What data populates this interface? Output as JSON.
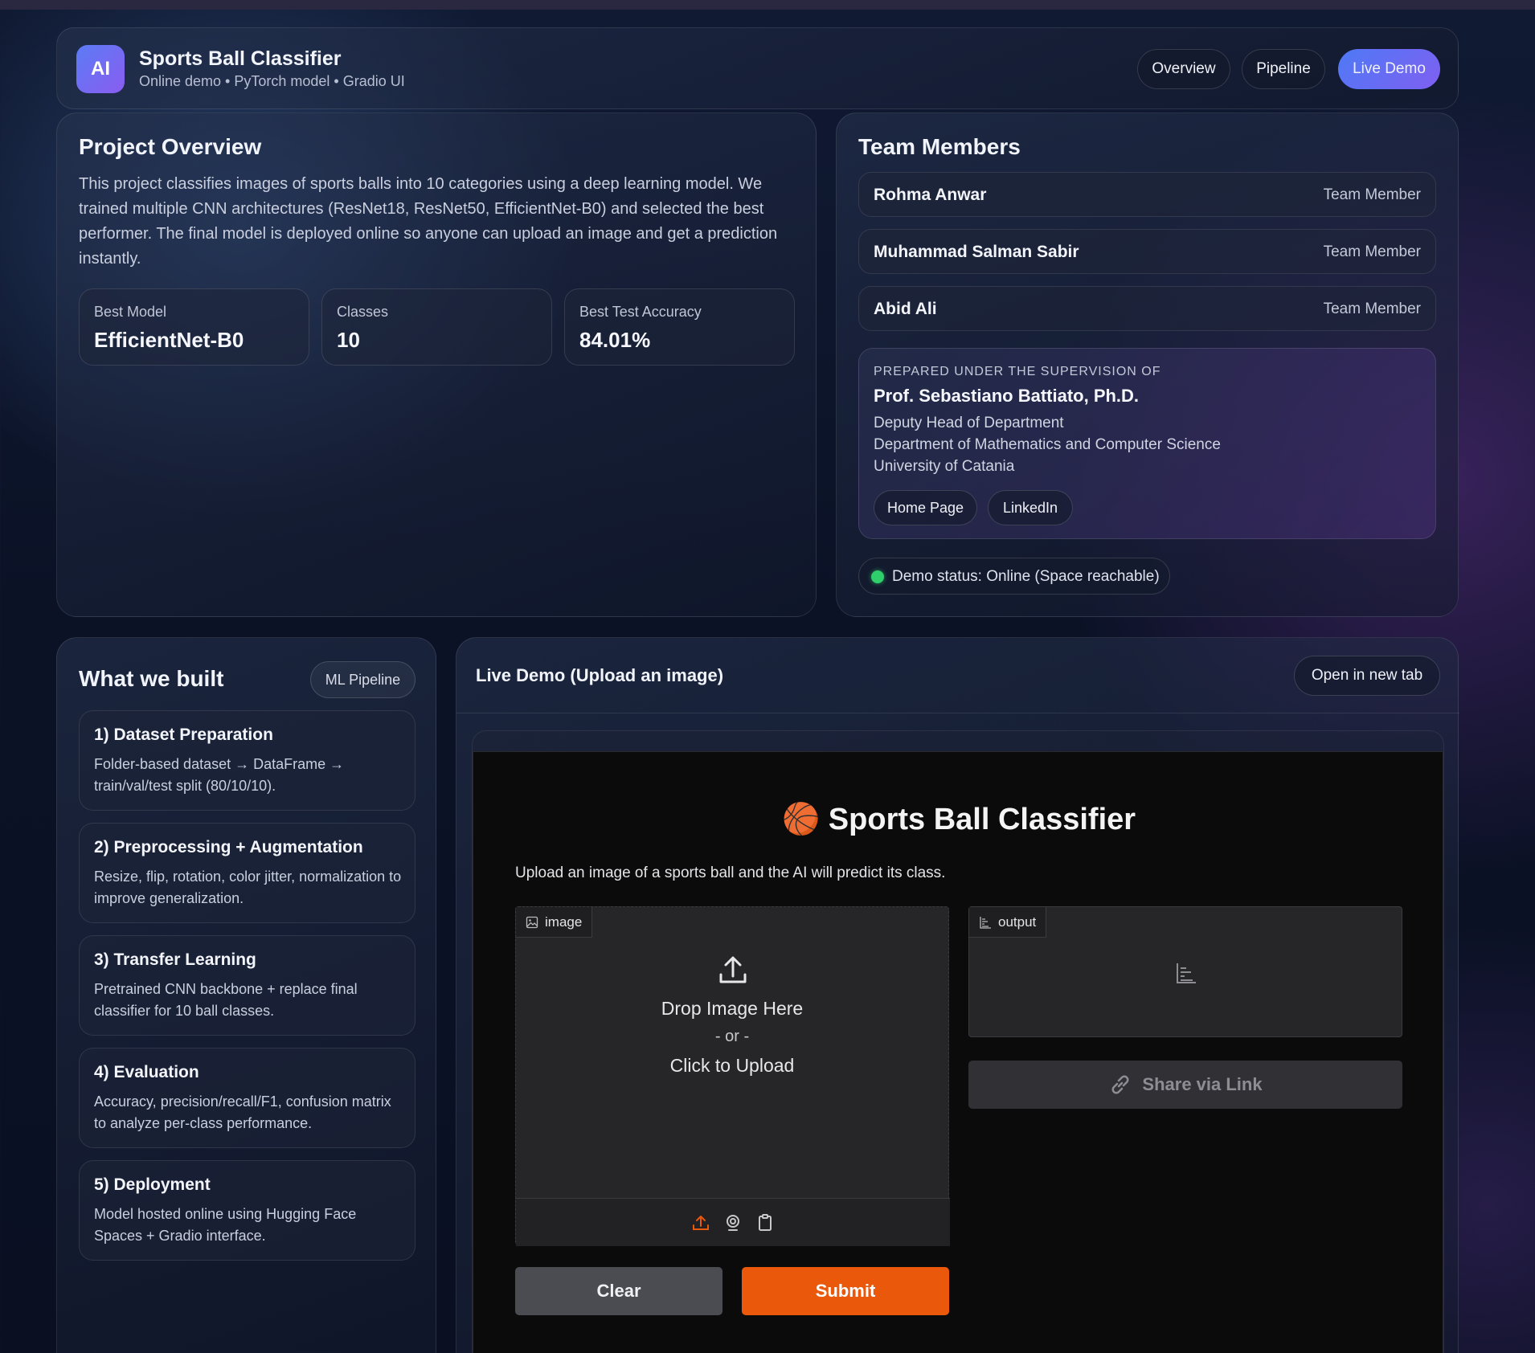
{
  "header": {
    "logo_text": "AI",
    "title": "Sports Ball Classifier",
    "subtitle": "Online demo • PyTorch model • Gradio UI",
    "nav": [
      {
        "label": "Overview",
        "active": false
      },
      {
        "label": "Pipeline",
        "active": false
      },
      {
        "label": "Live Demo",
        "active": true
      }
    ]
  },
  "overview": {
    "title": "Project Overview",
    "text": "This project classifies images of sports balls into 10 categories using a deep learning model. We trained multiple CNN architectures (ResNet18, ResNet50, EfficientNet-B0) and selected the best performer. The final model is deployed online so anyone can upload an image and get a prediction instantly.",
    "stats": [
      {
        "label": "Best Model",
        "value": "EfficientNet-B0"
      },
      {
        "label": "Classes",
        "value": "10"
      },
      {
        "label": "Best Test Accuracy",
        "value": "84.01%"
      }
    ]
  },
  "team": {
    "title": "Team Members",
    "members": [
      {
        "name": "Rohma Anwar",
        "role": "Team Member"
      },
      {
        "name": "Muhammad Salman Sabir",
        "role": "Team Member"
      },
      {
        "name": "Abid Ali",
        "role": "Team Member"
      }
    ],
    "supervision": {
      "kicker": "PREPARED UNDER THE SUPERVISION OF",
      "name": "Prof. Sebastiano Battiato, Ph.D.",
      "lines": [
        "Deputy Head of Department",
        "Department of Mathematics and Computer Science",
        "University of Catania"
      ],
      "links": [
        "Home Page",
        "LinkedIn"
      ]
    },
    "status": "Demo status: Online (Space reachable)",
    "status_color": "#2fd06b"
  },
  "built": {
    "title": "What we built",
    "badge": "ML Pipeline",
    "steps": [
      {
        "title": "1) Dataset Preparation",
        "desc": "Folder-based dataset → DataFrame → train/val/test split (80/10/10)."
      },
      {
        "title": "2) Preprocessing + Augmentation",
        "desc": "Resize, flip, rotation, color jitter, normalization to improve generalization."
      },
      {
        "title": "3) Transfer Learning",
        "desc": "Pretrained CNN backbone + replace final classifier for 10 ball classes."
      },
      {
        "title": "4) Evaluation",
        "desc": "Accuracy, precision/recall/F1, confusion matrix to analyze per-class performance."
      },
      {
        "title": "5) Deployment",
        "desc": "Model hosted online using Hugging Face Spaces + Gradio interface."
      }
    ]
  },
  "demo": {
    "title": "Live Demo (Upload an image)",
    "open_tab": "Open in new tab",
    "gradio": {
      "title": "🏀 Sports Ball Classifier",
      "description": "Upload an image of a sports ball and the AI will predict its class.",
      "image_tab": "image",
      "drop_main": "Drop Image Here",
      "drop_or": "- or -",
      "drop_click": "Click to Upload",
      "output_tab": "output",
      "share": "Share via Link",
      "clear": "Clear",
      "submit": "Submit",
      "accent": "#ea580c"
    }
  }
}
